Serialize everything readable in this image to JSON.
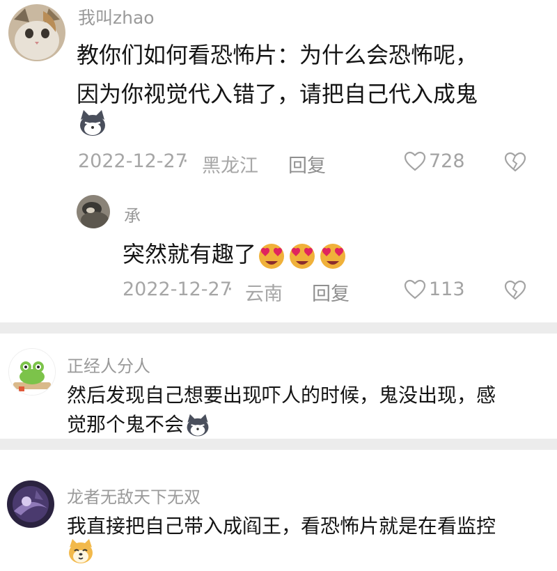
{
  "comments": [
    {
      "username": "我叫zhao",
      "text_lines": [
        "教你们如何看恐怖片：为什么会恐怖呢，",
        "因为你视觉代入错了，请把自己代入成鬼"
      ],
      "emoji": "cat-face-emoji",
      "date": "2022-12-27",
      "location": "黑龙江",
      "reply_label": "回复",
      "likes": "728",
      "replies": [
        {
          "username": "承",
          "text": "突然就有趣了",
          "emojis": [
            "heart-eyes-emoji",
            "heart-eyes-emoji",
            "heart-eyes-emoji"
          ],
          "date": "2022-12-27",
          "location": "云南",
          "reply_label": "回复",
          "likes": "113"
        }
      ]
    },
    {
      "username": "正经人分人",
      "text_lines": [
        "然后发现自己想要出现吓人的时候，鬼没出现，感",
        "觉那个鬼不会"
      ],
      "emoji": "cat-face-emoji"
    },
    {
      "username": "龙者无敌天下无双",
      "text_lines": [
        "我直接把自己带入成阎王，看恐怖片就是在看监控"
      ],
      "emoji": "shiba-dog-emoji"
    }
  ],
  "meta_separator": "·",
  "colors": {
    "text": "#141414",
    "username": "#9a9a9a",
    "meta": "#a6a6a6",
    "separator": "#ececec"
  }
}
